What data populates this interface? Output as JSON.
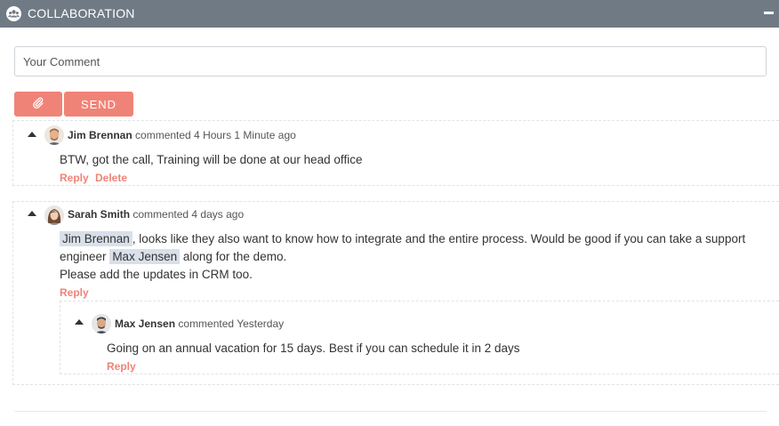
{
  "panel": {
    "title": "COLLABORATION",
    "icon": "users-icon",
    "collapse_icon": "minus-icon"
  },
  "composer": {
    "placeholder": "Your Comment",
    "attach_icon": "paperclip-icon",
    "send_label": "SEND",
    "button_color": "#f08377"
  },
  "comments": [
    {
      "author": "Jim Brennan",
      "meta": "commented 4 Hours 1 Minute ago",
      "text": "BTW, got the call, Training will be done at our head office",
      "reply_label": "Reply",
      "delete_label": "Delete"
    },
    {
      "author": "Sarah Smith",
      "meta": "commented 4 days ago",
      "mention1": "Jim Brennan",
      "text_a": ", looks like they also want to know how to integrate and the entire process. Would be good if you can take a support",
      "text_b": "engineer",
      "mention2": "Max Jensen",
      "text_c": "along for the demo.",
      "text_d": "Please add the updates in CRM too.",
      "reply_label": "Reply",
      "replies": [
        {
          "author": "Max Jensen",
          "meta": "commented Yesterday",
          "text": "Going on an annual vacation for 15 days. Best if you can schedule it in 2 days",
          "reply_label": "Reply"
        }
      ]
    }
  ],
  "colors": {
    "header_bg": "#6f7a85",
    "accent": "#f08377",
    "mention_bg": "#d9e0ea"
  }
}
